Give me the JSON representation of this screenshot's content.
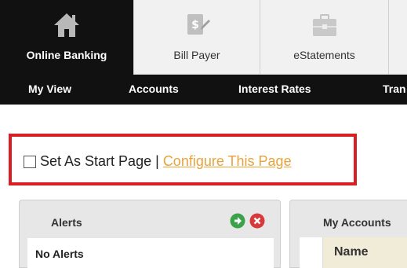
{
  "top_tabs": [
    {
      "label": "Online Banking",
      "icon": "home-icon",
      "active": true
    },
    {
      "label": "Bill Payer",
      "icon": "bill-payer-icon",
      "active": false
    },
    {
      "label": "eStatements",
      "icon": "briefcase-icon",
      "active": false
    }
  ],
  "sub_nav": [
    {
      "label": "My View"
    },
    {
      "label": "Accounts"
    },
    {
      "label": "Interest Rates"
    },
    {
      "label": "Tran"
    }
  ],
  "start_page": {
    "checkbox_label": "Set As Start Page",
    "separator": "|",
    "configure_link": "Configure This Page",
    "highlight_color": "#d81f26",
    "link_color": "#e8a33a"
  },
  "alerts_panel": {
    "title": "Alerts",
    "empty_text": "No Alerts",
    "add_button": "add-icon",
    "close_button": "close-icon"
  },
  "accounts_panel": {
    "title": "My Accounts",
    "column_header": "Name"
  }
}
